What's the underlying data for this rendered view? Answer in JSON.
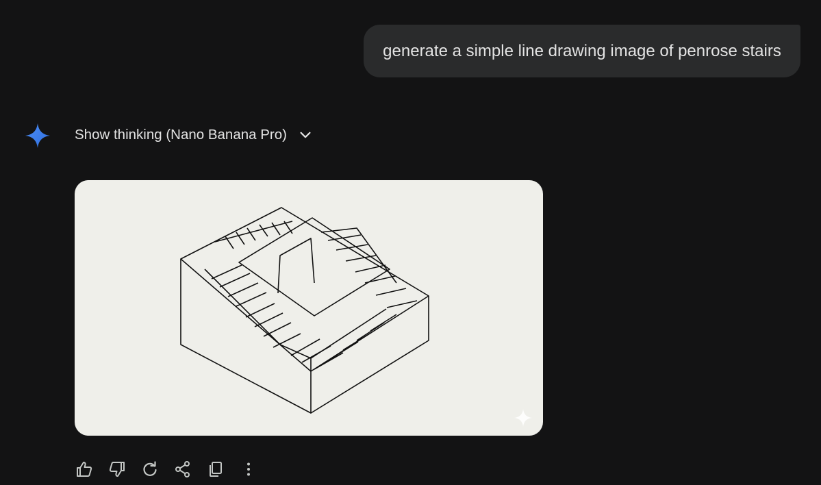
{
  "colors": {
    "background": "#131314",
    "bubble": "#2a2b2c",
    "text": "#e3e3e3",
    "gemini_blue": "#4285f4",
    "icon": "#c4c7c5"
  },
  "user_message": {
    "text": "generate a simple line drawing image of penrose stairs"
  },
  "response": {
    "thinking_label": "Show thinking (Nano Banana Pro)",
    "icons": {
      "assistant": "gemini-spark-icon",
      "expand": "chevron-down-icon",
      "watermark": "sparkle-watermark-icon"
    }
  },
  "actions": [
    {
      "name": "thumbs-up-icon"
    },
    {
      "name": "thumbs-down-icon"
    },
    {
      "name": "regenerate-icon"
    },
    {
      "name": "share-icon"
    },
    {
      "name": "copy-icon"
    },
    {
      "name": "more-options-icon"
    }
  ]
}
